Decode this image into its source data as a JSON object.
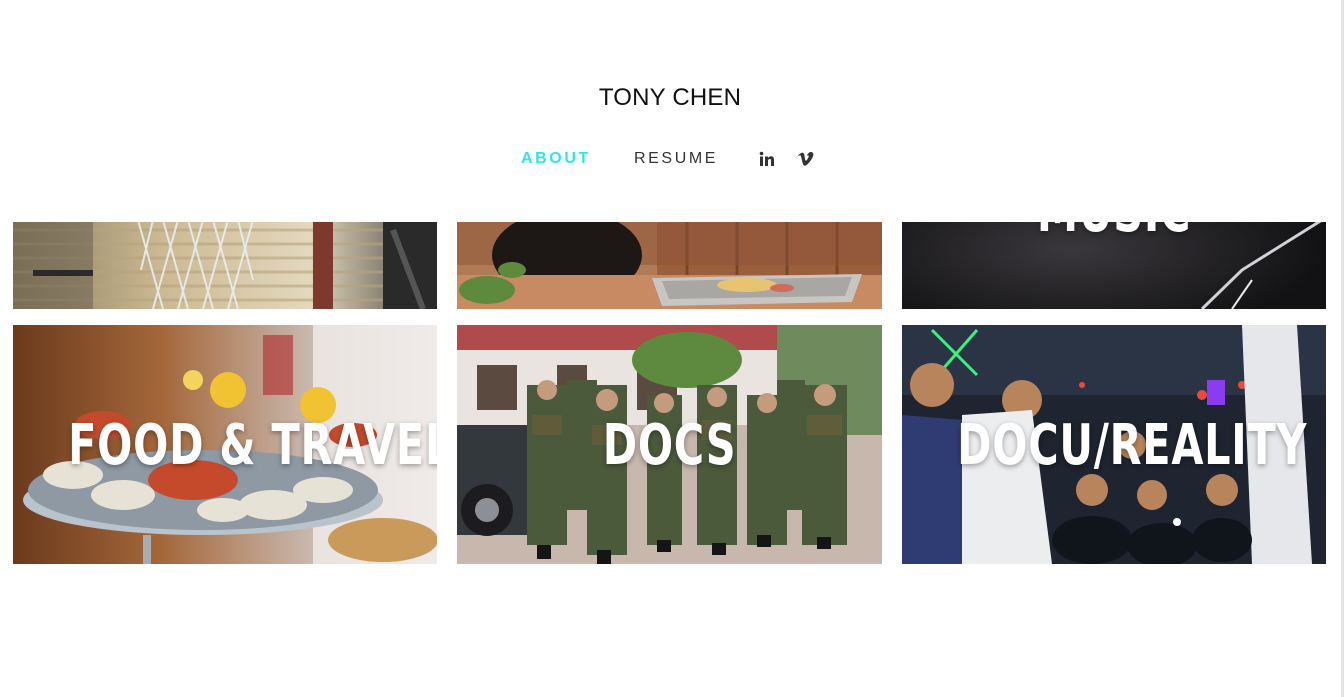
{
  "header": {
    "title": "TONY CHEN"
  },
  "nav": {
    "items": [
      {
        "label": "ABOUT",
        "active": true
      },
      {
        "label": "RESUME",
        "active": false
      }
    ],
    "social": [
      {
        "icon": "linkedin-icon"
      },
      {
        "icon": "vimeo-icon"
      }
    ],
    "accent_color": "#2fe6e6"
  },
  "grid": {
    "top_row": [
      {
        "image": "basketball-net"
      },
      {
        "image": "bear-with-food-tray"
      },
      {
        "label": "MUSIC",
        "image": "dark-concert-stage"
      }
    ],
    "bottom_row": [
      {
        "label": "FOOD & TRAVEL",
        "image": "seafood-platter"
      },
      {
        "label": "DOCS",
        "image": "soldiers-marching"
      },
      {
        "label": "DOCU/REALITY",
        "image": "concert-crowd"
      }
    ]
  }
}
